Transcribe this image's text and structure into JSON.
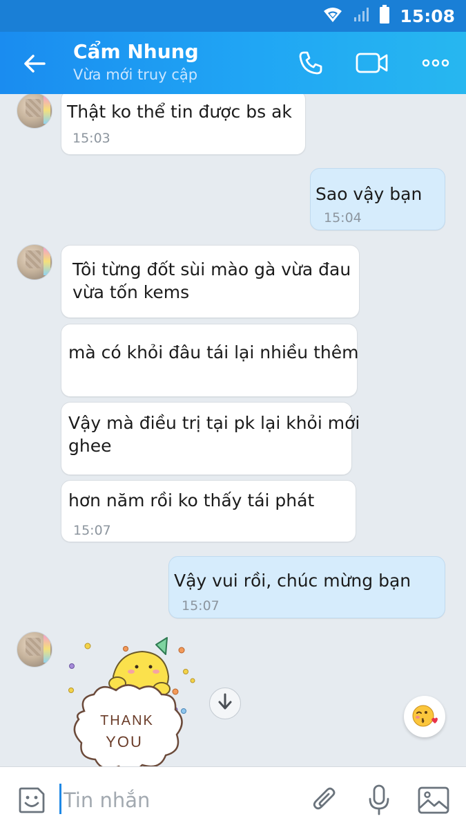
{
  "status_bar": {
    "time": "15:08",
    "icons": [
      "wifi-icon",
      "signal-icon",
      "battery-icon"
    ]
  },
  "header": {
    "contact_name": "Cẩm Nhung",
    "contact_status": "Vừa mới truy cập",
    "icons": [
      "back-arrow-icon",
      "phone-icon",
      "video-call-icon",
      "more-options-icon"
    ]
  },
  "messages": [
    {
      "sender": "them",
      "lines": [
        "Thật ko thể tin được bs ak"
      ],
      "time": "15:03"
    },
    {
      "sender": "me",
      "lines": [
        "Sao vậy bạn"
      ],
      "time": "15:04"
    },
    {
      "sender": "them",
      "lines": [
        "Tôi từng đốt sùi mào gà vừa đau",
        "vừa tốn kems"
      ],
      "time": ""
    },
    {
      "sender": "them",
      "lines": [
        "mà có khỏi đâu tái lại nhiều thêm"
      ],
      "time": ""
    },
    {
      "sender": "them",
      "lines": [
        "Vậy mà điều trị tại pk lại khỏi mới",
        "ghee"
      ],
      "time": ""
    },
    {
      "sender": "them",
      "lines": [
        "hơn năm rồi ko thấy tái phát"
      ],
      "time": "15:07"
    },
    {
      "sender": "me",
      "lines": [
        "Vậy vui rồi, chúc mừng bạn"
      ],
      "time": "15:07"
    }
  ],
  "sticker": {
    "text_line1": "THANK",
    "text_line2": "YOU",
    "icon": "thank-you-sticker"
  },
  "input_bar": {
    "placeholder": "Tin nhắn",
    "icons": [
      "sticker-icon",
      "attachment-icon",
      "microphone-icon",
      "image-icon"
    ]
  },
  "colors": {
    "header_start": "#1a8cf0",
    "header_end": "#27b7f0",
    "chat_background": "#e6ebf0",
    "my_bubble": "#d6ecfc",
    "their_bubble": "#ffffff",
    "accent": "#1e88e5"
  }
}
